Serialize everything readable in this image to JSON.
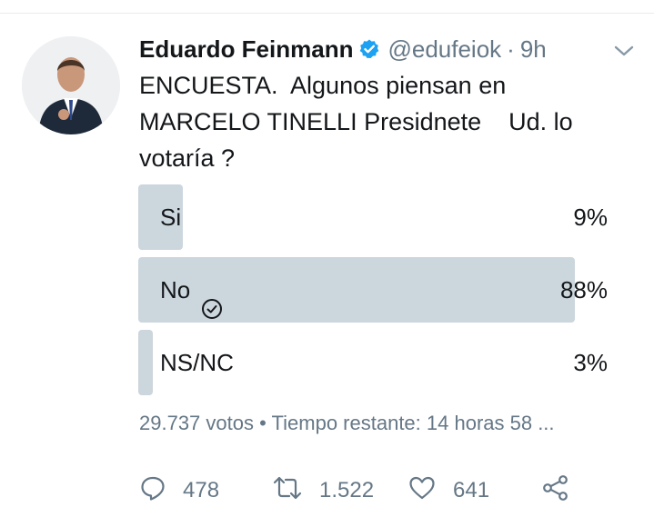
{
  "tweet": {
    "author_name": "Eduardo Feinmann",
    "handle": "@edufeiok",
    "separator": "·",
    "time": "9h",
    "text": "ENCUESTA.  Algunos piensan en\nMARCELO TINELLI Presidnete    Ud. lo\nvotaría ?"
  },
  "poll": {
    "options": [
      {
        "label": "Si",
        "percent_text": "9%",
        "percent": 9,
        "selected": false
      },
      {
        "label": "No",
        "percent_text": "88%",
        "percent": 88,
        "selected": true
      },
      {
        "label": "NS/NC",
        "percent_text": "3%",
        "percent": 3,
        "selected": false
      }
    ],
    "meta": "29.737 votos • Tiempo restante: 14 horas 58 ..."
  },
  "actions": {
    "replies": "478",
    "retweets": "1.522",
    "likes": "641"
  },
  "icons": {
    "verified": "verified-badge-icon",
    "caret": "chevron-down-icon",
    "selected_option": "check-circle-icon",
    "reply": "reply-icon",
    "retweet": "retweet-icon",
    "like": "heart-icon",
    "share": "share-icon"
  },
  "colors": {
    "bar": "#ccd6dd",
    "verified": "#1da1f2",
    "muted": "#657786",
    "text": "#14171a"
  }
}
